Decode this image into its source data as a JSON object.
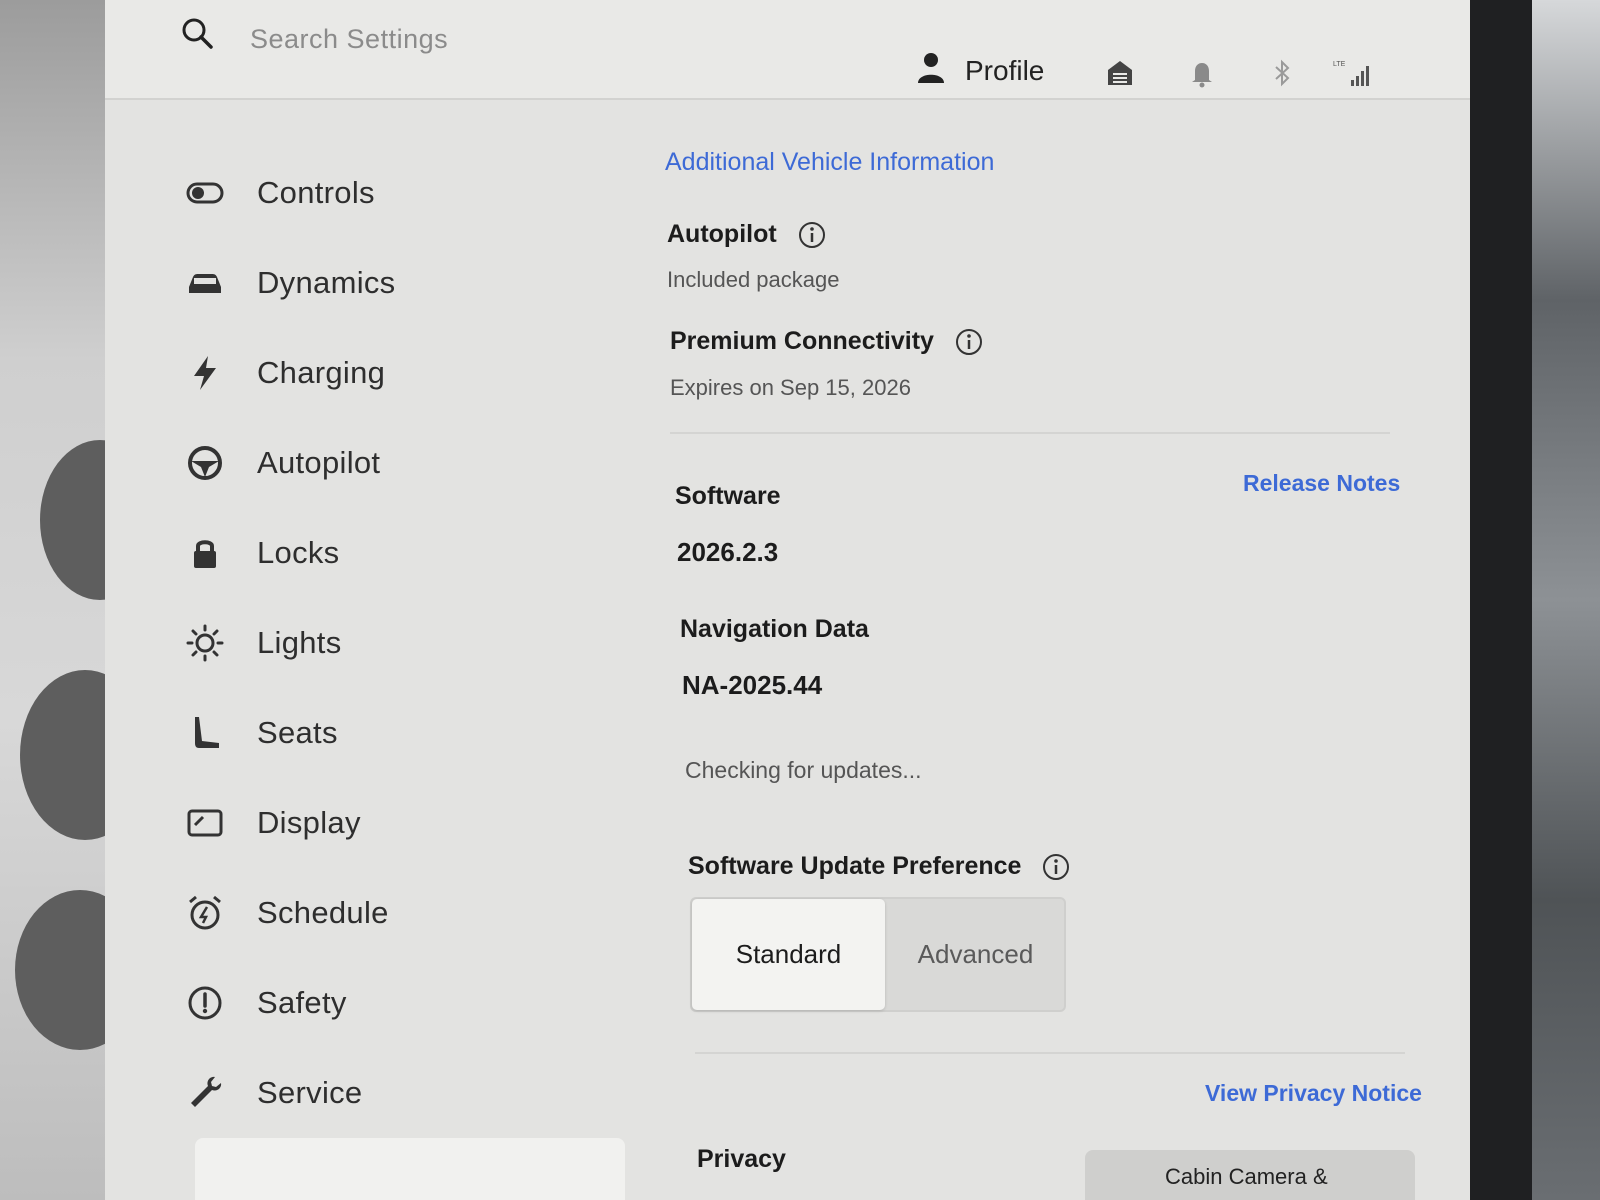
{
  "search": {
    "placeholder": "Search Settings"
  },
  "topbar": {
    "profile_label": "Profile",
    "status_icons": [
      "garage-icon",
      "bell-icon",
      "bluetooth-icon",
      "lte-signal-icon"
    ],
    "lte_label": "LTE"
  },
  "sidebar": {
    "items": [
      {
        "label": "Controls",
        "icon": "toggle-icon"
      },
      {
        "label": "Dynamics",
        "icon": "car-icon"
      },
      {
        "label": "Charging",
        "icon": "lightning-icon"
      },
      {
        "label": "Autopilot",
        "icon": "steering-wheel-icon"
      },
      {
        "label": "Locks",
        "icon": "lock-icon"
      },
      {
        "label": "Lights",
        "icon": "light-bulb-icon"
      },
      {
        "label": "Seats",
        "icon": "seat-icon"
      },
      {
        "label": "Display",
        "icon": "display-icon"
      },
      {
        "label": "Schedule",
        "icon": "alarm-clock-icon"
      },
      {
        "label": "Safety",
        "icon": "alert-circle-icon"
      },
      {
        "label": "Service",
        "icon": "wrench-icon"
      }
    ]
  },
  "content": {
    "additional_info_link": "Additional Vehicle Information",
    "autopilot": {
      "title": "Autopilot",
      "value": "Included package"
    },
    "connectivity": {
      "title": "Premium Connectivity",
      "value": "Expires on Sep 15, 2026"
    },
    "software": {
      "title": "Software",
      "version": "2026.2.3",
      "release_notes_link": "Release Notes"
    },
    "navigation": {
      "title": "Navigation Data",
      "value": "NA-2025.44"
    },
    "update_status": "Checking for updates...",
    "update_preference": {
      "title": "Software Update Preference",
      "options": [
        "Standard",
        "Advanced"
      ],
      "selected": "Standard"
    },
    "privacy": {
      "title": "Privacy",
      "notice_link": "View Privacy Notice",
      "cabin_camera_label": "Cabin Camera &"
    }
  },
  "colors": {
    "accent": "#3d6ad6",
    "screen_bg": "#e3e3e1",
    "text": "#1c1c1c"
  }
}
